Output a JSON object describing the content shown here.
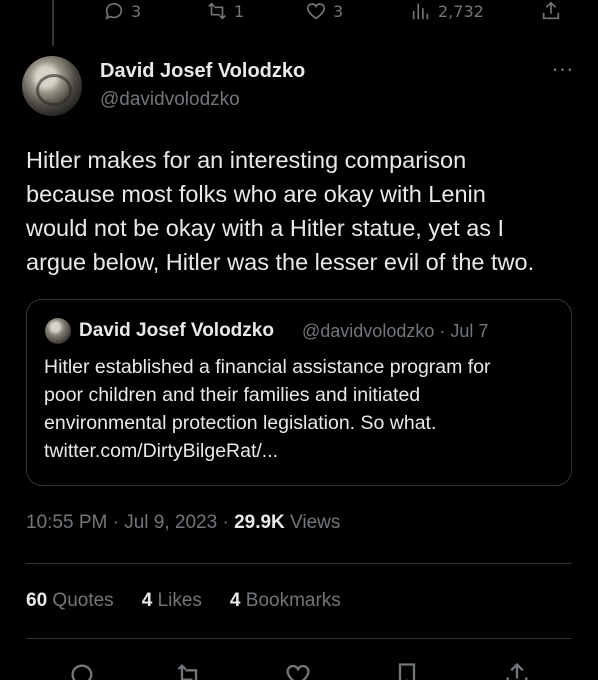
{
  "top_actions": {
    "replies": "3",
    "retweets": "1",
    "likes": "3",
    "views": "2,732"
  },
  "author": {
    "name": "David Josef Volodzko",
    "handle": "@davidvolodzko"
  },
  "tweet": {
    "text": "Hitler makes for an interesting comparison\nbecause most folks who are okay with Lenin\nwould not be okay with a Hitler statue, yet as I\nargue below, Hitler was the lesser evil of the two."
  },
  "quote": {
    "name": "David Josef Volodzko",
    "meta": "@davidvolodzko · Jul 7",
    "text": "Hitler established a financial assistance program for\npoor children and their families and initiated\nenvironmental protection legislation. So what.\ntwitter.com/DirtyBilgeRat/..."
  },
  "timestamp": {
    "time": "10:55 PM · Jul 9, 2023 · ",
    "views_count": "29.9K",
    "views_label": " Views"
  },
  "stats": {
    "quotes_count": "60",
    "quotes_label": "Quotes",
    "likes_count": "4",
    "likes_label": "Likes",
    "bookmarks_count": "4",
    "bookmarks_label": "Bookmarks"
  },
  "more_label": "···",
  "colors": {
    "background": "#000000",
    "text": "#e7e9ea",
    "muted": "#71767b",
    "border": "#2f3336"
  }
}
